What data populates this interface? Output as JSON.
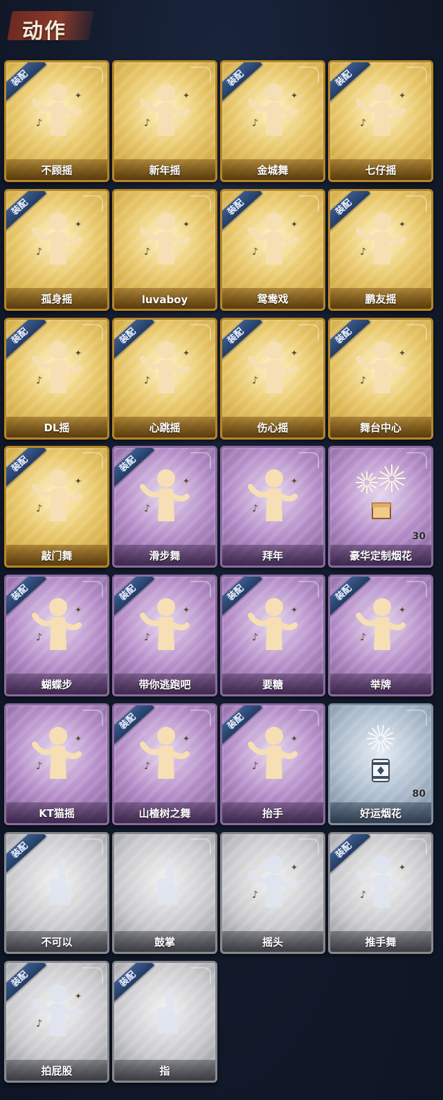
{
  "header": {
    "title": "动作"
  },
  "equip_label": "装配",
  "cards": [
    {
      "label": "不顾摇",
      "tier": "gold",
      "equipped": true,
      "icon": "figure-point-icon"
    },
    {
      "label": "新年摇",
      "tier": "gold",
      "equipped": false,
      "icon": "figure-clap-icon"
    },
    {
      "label": "金城舞",
      "tier": "gold",
      "equipped": true,
      "icon": "figure-wave-icon"
    },
    {
      "label": "七仔摇",
      "tier": "gold",
      "equipped": true,
      "icon": "figure-arms-cross-icon"
    },
    {
      "label": "孤身摇",
      "tier": "gold",
      "equipped": true,
      "icon": "figure-sway-icon"
    },
    {
      "label": "luvaboy",
      "tier": "gold",
      "equipped": false,
      "icon": "figure-cross-arms-icon"
    },
    {
      "label": "鸳鸯戏",
      "tier": "gold",
      "equipped": true,
      "icon": "figure-music-icon"
    },
    {
      "label": "鹏友摇",
      "tier": "gold",
      "equipped": true,
      "icon": "figure-hand-chest-icon"
    },
    {
      "label": "DL摇",
      "tier": "gold",
      "equipped": true,
      "icon": "figure-arm-up-icon"
    },
    {
      "label": "心跳摇",
      "tier": "gold",
      "equipped": true,
      "icon": "figure-hand-head-icon"
    },
    {
      "label": "伤心摇",
      "tier": "gold",
      "equipped": true,
      "icon": "figure-heart-hands-icon"
    },
    {
      "label": "舞台中心",
      "tier": "gold",
      "equipped": true,
      "icon": "figure-center-stage-icon"
    },
    {
      "label": "敲门舞",
      "tier": "gold",
      "equipped": true,
      "icon": "figure-knock-icon"
    },
    {
      "label": "滑步舞",
      "tier": "purple",
      "equipped": true,
      "icon": "figure-slide-icon"
    },
    {
      "label": "拜年",
      "tier": "purple",
      "equipped": false,
      "icon": "figure-bow-icon"
    },
    {
      "label": "豪华定制烟花",
      "tier": "purple",
      "equipped": false,
      "icon": "fireworks-box-icon",
      "count": "30"
    },
    {
      "label": "蝴蝶步",
      "tier": "purple",
      "equipped": true,
      "icon": "figure-butterfly-icon"
    },
    {
      "label": "带你逃跑吧",
      "tier": "purple",
      "equipped": true,
      "icon": "figure-run-icon"
    },
    {
      "label": "要糖",
      "tier": "purple",
      "equipped": true,
      "icon": "figure-candy-icon"
    },
    {
      "label": "举牌",
      "tier": "purple",
      "equipped": true,
      "icon": "figure-sign-icon"
    },
    {
      "label": "KT猫摇",
      "tier": "purple",
      "equipped": false,
      "icon": "figure-cat-icon"
    },
    {
      "label": "山楂树之舞",
      "tier": "purple",
      "equipped": true,
      "icon": "figure-tree-dance-icon"
    },
    {
      "label": "抬手",
      "tier": "purple",
      "equipped": true,
      "icon": "figure-raise-hand-icon"
    },
    {
      "label": "好运烟花",
      "tier": "blue",
      "equipped": false,
      "icon": "firework-can-icon",
      "count": "80"
    },
    {
      "label": "不可以",
      "tier": "grey",
      "equipped": true,
      "icon": "finger-no-icon"
    },
    {
      "label": "鼓掌",
      "tier": "grey",
      "equipped": false,
      "icon": "clap-hands-icon"
    },
    {
      "label": "摇头",
      "tier": "grey",
      "equipped": false,
      "icon": "figure-shake-head-icon"
    },
    {
      "label": "推手舞",
      "tier": "grey",
      "equipped": true,
      "icon": "figure-push-hands-icon"
    },
    {
      "label": "拍屁股",
      "tier": "grey",
      "equipped": true,
      "icon": "figure-slap-icon"
    },
    {
      "label": "指",
      "tier": "grey",
      "equipped": true,
      "icon": "pointing-hand-icon"
    }
  ]
}
